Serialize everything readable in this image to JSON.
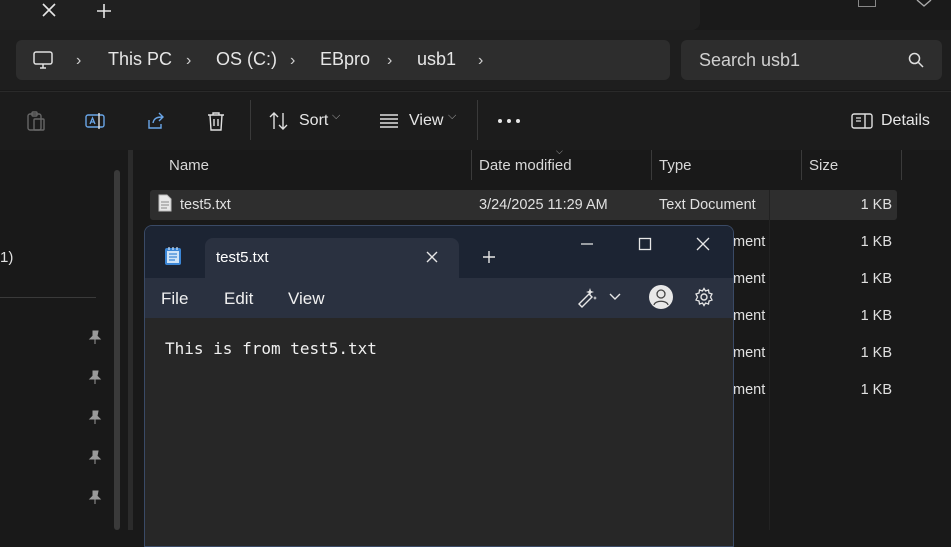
{
  "explorer": {
    "window_title": "",
    "breadcrumb": [
      "This PC",
      "OS (C:)",
      "EBpro",
      "usb1"
    ],
    "search_placeholder": "Search usb1",
    "toolbar": {
      "sort_label": "Sort",
      "view_label": "View",
      "details_label": "Details"
    },
    "columns": [
      "Name",
      "Date modified",
      "Type",
      "Size"
    ],
    "files": [
      {
        "name": "test5.txt",
        "date": "3/24/2025 11:29 AM",
        "type": "Text Document",
        "size": "1 KB"
      },
      {
        "type_partial": "ment",
        "size": "1 KB"
      },
      {
        "type_partial": "ment",
        "size": "1 KB"
      },
      {
        "type_partial": "ment",
        "size": "1 KB"
      },
      {
        "type_partial": "ment",
        "size": "1 KB"
      },
      {
        "type_partial": "ment",
        "size": "1 KB"
      }
    ],
    "nav_partial_text": "1)"
  },
  "notepad": {
    "tab_title": "test5.txt",
    "menu": [
      "File",
      "Edit",
      "View"
    ],
    "content": "This is from test5.txt"
  },
  "colors": {
    "background": "#191919",
    "notepad_bg": "#272727",
    "accent_border": "#3a4a66"
  },
  "icons": [
    "close-icon",
    "plus-icon",
    "monitor-icon",
    "search-icon",
    "paste-icon",
    "rename-icon",
    "share-icon",
    "delete-icon",
    "sort-icon",
    "view-icon",
    "more-icon",
    "details-pane-icon",
    "pin-icon",
    "notepad-icon",
    "minimize-icon",
    "maximize-icon",
    "copilot-icon",
    "account-icon",
    "settings-icon",
    "text-file-icon"
  ]
}
